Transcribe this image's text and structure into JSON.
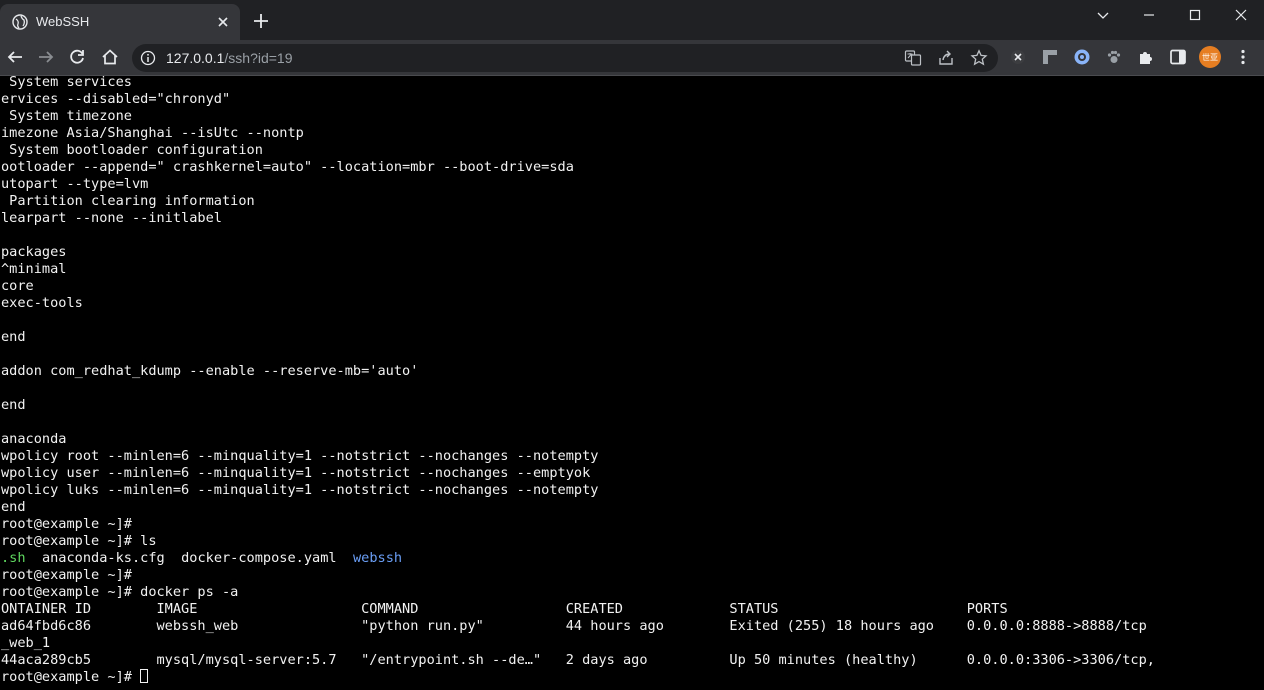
{
  "tab": {
    "title": "WebSSH"
  },
  "toolbar": {
    "url_host": "127.0.0.1",
    "url_path": "/ssh?id=19",
    "profile_label": "世亚"
  },
  "terminal": {
    "lines": [
      " System services",
      "ervices --disabled=\"chronyd\"",
      " System timezone",
      "imezone Asia/Shanghai --isUtc --nontp",
      " System bootloader configuration",
      "ootloader --append=\" crashkernel=auto\" --location=mbr --boot-drive=sda",
      "utopart --type=lvm",
      " Partition clearing information",
      "learpart --none --initlabel",
      "",
      "packages",
      "^minimal",
      "core",
      "exec-tools",
      "",
      "end",
      "",
      "addon com_redhat_kdump --enable --reserve-mb='auto'",
      "",
      "end",
      "",
      "anaconda",
      "wpolicy root --minlen=6 --minquality=1 --notstrict --nochanges --notempty",
      "wpolicy user --minlen=6 --minquality=1 --notstrict --nochanges --emptyok",
      "wpolicy luks --minlen=6 --minquality=1 --notstrict --nochanges --notempty",
      "end",
      "root@example ~]# ",
      "root@example ~]# ls",
      "ls_output",
      "root@example ~]# ",
      "root@example ~]# docker ps -a",
      "ONTAINER ID        IMAGE                    COMMAND                  CREATED             STATUS                       PORTS",
      "ad64fbd6c86        webssh_web               \"python run.py\"          44 hours ago        Exited (255) 18 hours ago    0.0.0.0:8888->8888/tcp",
      "_web_1",
      "44aca289cb5        mysql/mysql-server:5.7   \"/entrypoint.sh --de…\"   2 days ago          Up 50 minutes (healthy)      0.0.0.0:3306->3306/tcp,",
      "root@example ~]# "
    ],
    "ls_output": {
      "file1": ".sh",
      "gap1": "  ",
      "file2": "anaconda-ks.cfg",
      "gap2": "  ",
      "file3": "docker-compose.yaml",
      "gap3": "  ",
      "dir1": "webssh"
    }
  },
  "colors": {
    "tab_bg": "#35363a",
    "chrome_bg": "#202124",
    "terminal_bg": "#000000",
    "terminal_fg": "#f2f2f2",
    "exec_green": "#5fd75f",
    "dir_blue": "#6a9ef5"
  }
}
